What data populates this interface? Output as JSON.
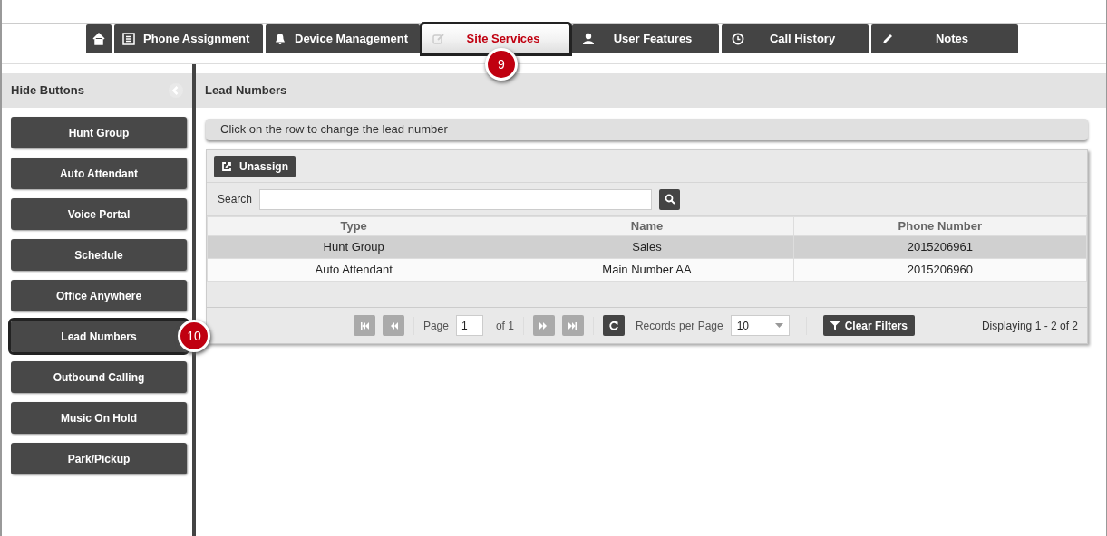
{
  "nav_tabs": [
    {
      "kind": "home",
      "selected": false
    },
    {
      "kind": "list",
      "label": "Phone Assignment",
      "selected": false
    },
    {
      "kind": "bell",
      "label": "Device Management",
      "selected": false
    },
    {
      "kind": "edit",
      "label": "Site Services",
      "selected": true,
      "callout": "9"
    },
    {
      "kind": "user",
      "label": "User Features",
      "selected": false
    },
    {
      "kind": "clock",
      "label": "Call History",
      "selected": false
    },
    {
      "kind": "pencil",
      "label": "Notes",
      "selected": false
    }
  ],
  "sidebar": {
    "title": "Hide Buttons",
    "items": [
      {
        "label": "Hunt Group",
        "selected": false
      },
      {
        "label": "Auto Attendant",
        "selected": false
      },
      {
        "label": "Voice Portal",
        "selected": false
      },
      {
        "label": "Schedule",
        "selected": false
      },
      {
        "label": "Office Anywhere",
        "selected": false
      },
      {
        "label": "Lead Numbers",
        "selected": true,
        "callout": "10"
      },
      {
        "label": "Outbound Calling",
        "selected": false
      },
      {
        "label": "Music On Hold",
        "selected": false
      },
      {
        "label": "Park/Pickup",
        "selected": false
      }
    ]
  },
  "panel": {
    "title": "Lead Numbers",
    "hint": "Click on the row to change the lead number",
    "unassign_button": "Unassign",
    "search_label": "Search",
    "table": {
      "columns": [
        "Type",
        "Name",
        "Phone Number"
      ],
      "rows": [
        {
          "cells": [
            "Hunt Group",
            "Sales",
            "2015206961"
          ],
          "selected": true
        },
        {
          "cells": [
            "Auto Attendant",
            "Main Number AA",
            "2015206960"
          ],
          "selected": false
        }
      ]
    },
    "pager": {
      "page_label": "Page",
      "page": "1",
      "of": "of 1",
      "records_label": "Records per Page",
      "records": "10",
      "clear_filters": "Clear Filters",
      "displaying": "Displaying 1 - 2 of 2"
    }
  }
}
